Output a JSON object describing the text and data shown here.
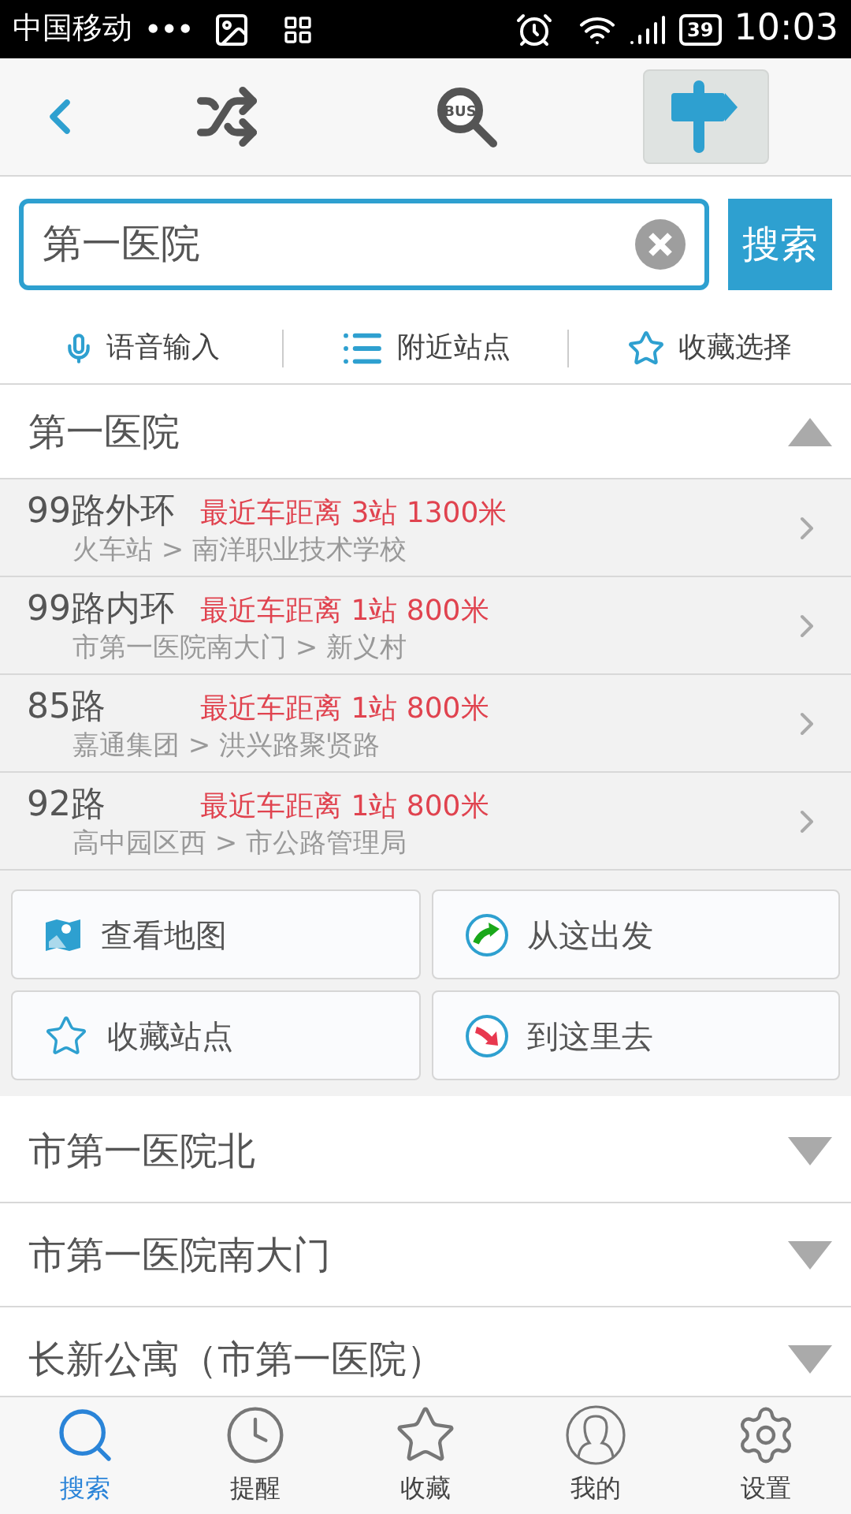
{
  "status_bar": {
    "carrier": "中国移动",
    "dots": "•••",
    "battery": "39",
    "time": "10:03"
  },
  "toolbar": [
    {
      "kind": "back",
      "selected": false
    },
    {
      "kind": "shuffle",
      "selected": false
    },
    {
      "kind": "bus_search",
      "label": "BUS",
      "selected": false
    },
    {
      "kind": "signpost",
      "selected": true
    }
  ],
  "search": {
    "value": "第一医院",
    "button": "搜索"
  },
  "quick_actions": [
    {
      "kind": "voice",
      "label": "语音输入"
    },
    {
      "kind": "nearby",
      "label": "附近站点"
    },
    {
      "kind": "favorites",
      "label": "收藏选择"
    }
  ],
  "stations": [
    {
      "name": "第一医院",
      "expanded": true,
      "routes": [
        {
          "line": "99路外环",
          "distance": "最近车距离 3站 1300米",
          "path": "火车站 > 南洋职业技术学校"
        },
        {
          "line": "99路内环",
          "distance": "最近车距离 1站 800米",
          "path": "市第一医院南大门 > 新义村"
        },
        {
          "line": "85路",
          "distance": "最近车距离 1站 800米",
          "path": "嘉通集团 > 洪兴路聚贤路"
        },
        {
          "line": "92路",
          "distance": "最近车距离 1站 800米",
          "path": "高中园区西 > 市公路管理局"
        }
      ],
      "actions": [
        {
          "kind": "map",
          "label": "查看地图"
        },
        {
          "kind": "depart",
          "label": "从这出发"
        },
        {
          "kind": "favorite",
          "label": "收藏站点"
        },
        {
          "kind": "arrive",
          "label": "到这里去"
        }
      ]
    },
    {
      "name": "市第一医院北",
      "expanded": false
    },
    {
      "name": "市第一医院南大门",
      "expanded": false
    },
    {
      "name": "长新公寓（市第一医院）",
      "expanded": false
    }
  ],
  "tab_bar": [
    {
      "kind": "search",
      "label": "搜索",
      "selected": true
    },
    {
      "kind": "reminder",
      "label": "提醒",
      "selected": false
    },
    {
      "kind": "favorites",
      "label": "收藏",
      "selected": false
    },
    {
      "kind": "mine",
      "label": "我的",
      "selected": false
    },
    {
      "kind": "settings",
      "label": "设置",
      "selected": false
    }
  ]
}
